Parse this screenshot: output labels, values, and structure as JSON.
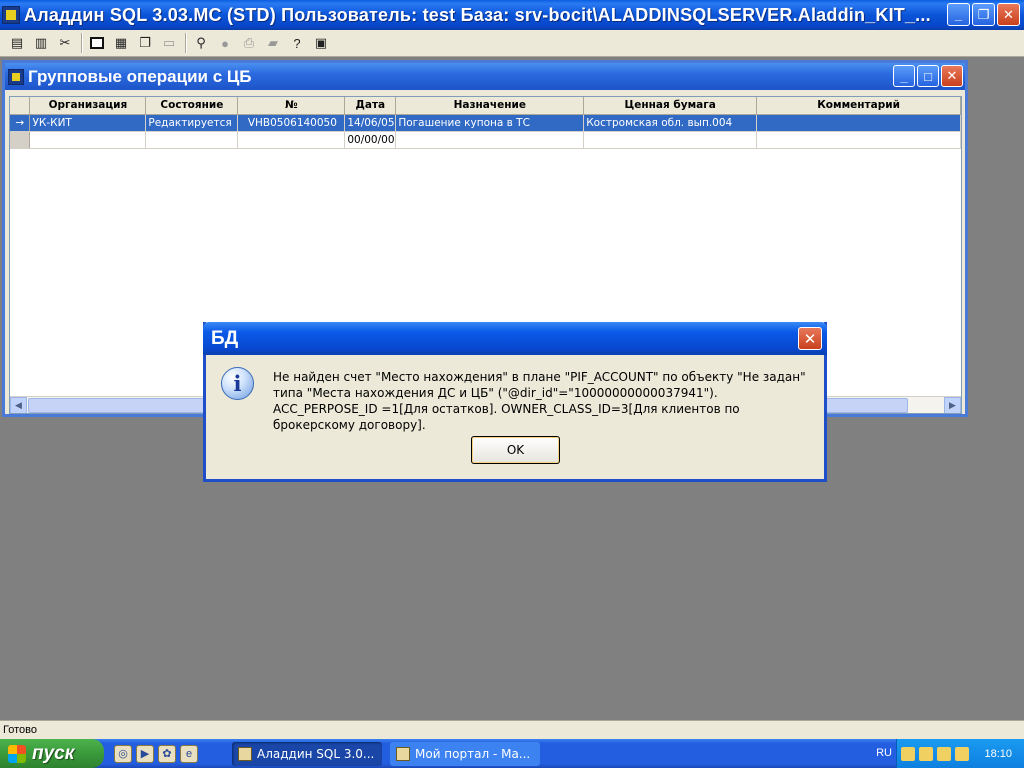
{
  "window": {
    "title": "Аладдин SQL 3.03.MC (STD)  Пользователь: test База: srv-bocit\\ALADDINSQLSERVER.Aladdin_KIT_..."
  },
  "child": {
    "title": "Групповые операции с ЦБ",
    "columns": [
      "",
      "Организация",
      "Состояние",
      "№",
      "Дата",
      "Назначение",
      "Ценная бумага",
      "Комментарий"
    ],
    "rows": [
      [
        "→",
        "УК-КИТ",
        "Редактируется",
        "VHB0506140050",
        "14/06/05",
        "Погашение купона в ТС",
        "Костромская обл. вып.004",
        ""
      ],
      [
        "",
        "",
        "",
        "",
        "00/00/00",
        "",
        "",
        ""
      ]
    ]
  },
  "dialog": {
    "title": "БД",
    "message": "Не найден счет \"Место нахождения\" в плане \"PIF_ACCOUNT\" по объекту \"Не задан\" типа \"Места нахождения ДС и ЦБ\" (\"@dir_id\"=\"10000000000037941\"). ACC_PERPOSE_ID =1[Для остатков]. OWNER_CLASS_ID=3[Для клиентов по брокерскому договору].",
    "ok_label": "OK"
  },
  "statusbar": {
    "text": "Готово"
  },
  "taskbar": {
    "start_label": "пуск",
    "tasks": [
      "Аладдин SQL 3.0...",
      "Мой портал - Ма..."
    ],
    "lang": "RU",
    "clock": "18:10"
  }
}
